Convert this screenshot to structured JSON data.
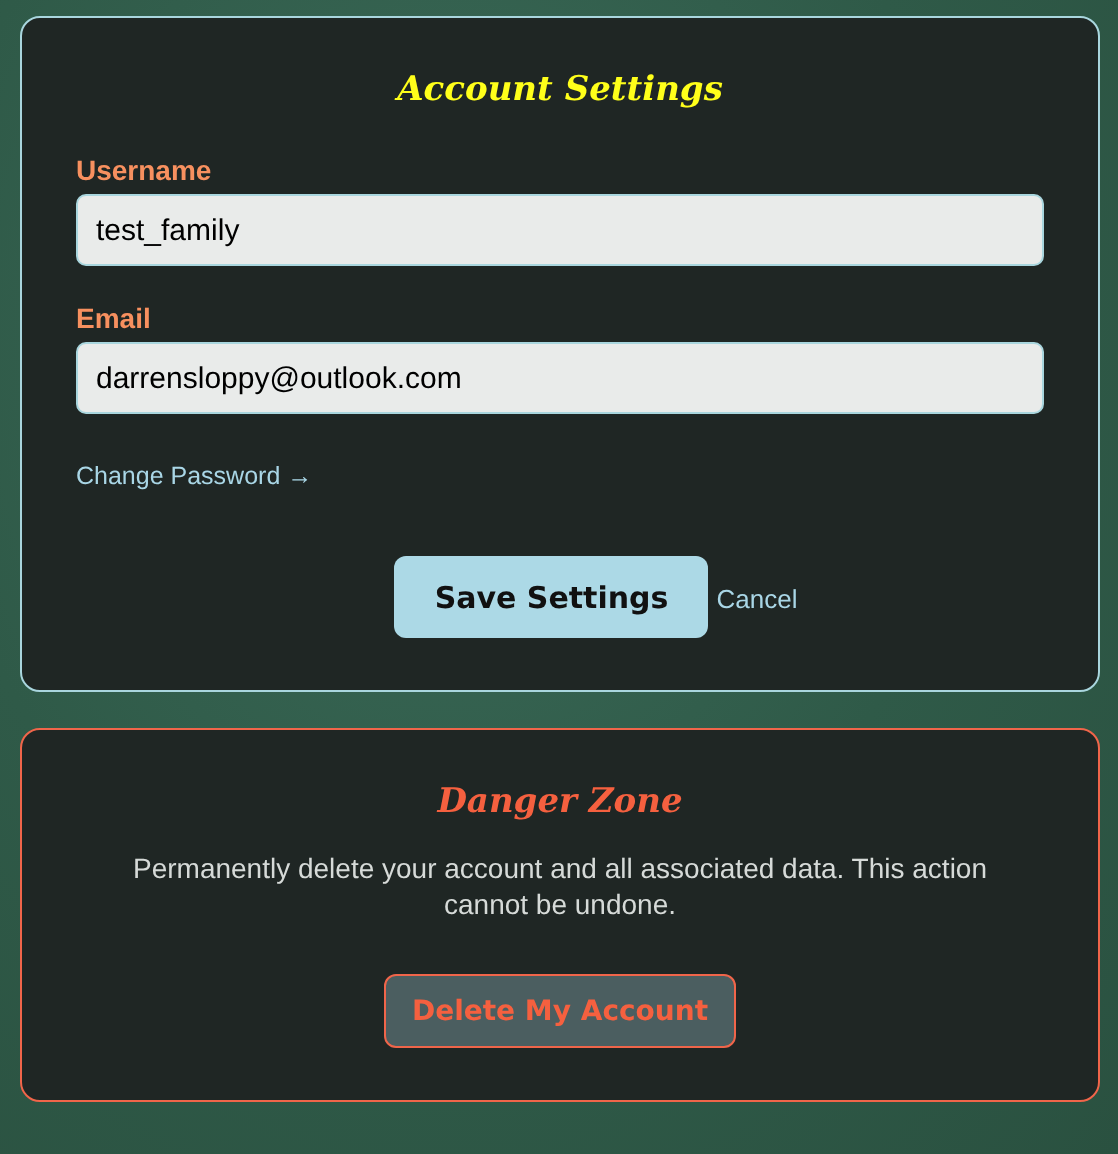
{
  "settings": {
    "title": "Account Settings",
    "fields": [
      {
        "label": "Username",
        "value": "test_family"
      },
      {
        "label": "Email",
        "value": "darrensloppy@outlook.com"
      }
    ],
    "change_password_link": "Change Password →",
    "save_button": "Save Settings",
    "cancel_link": "Cancel"
  },
  "danger_zone": {
    "title": "Danger Zone",
    "description": "Permanently delete your account and all associated data. This action cannot be undone.",
    "delete_button": "Delete My Account"
  }
}
